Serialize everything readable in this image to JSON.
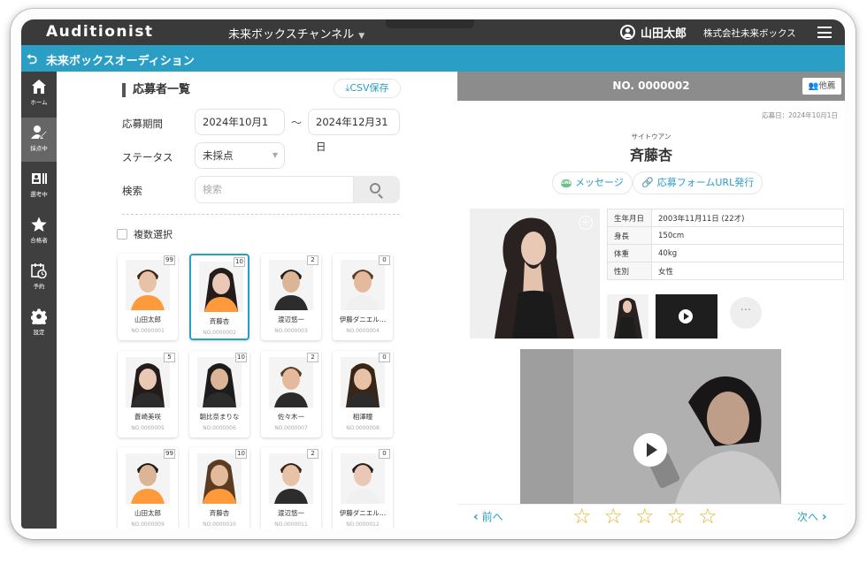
{
  "topbar": {
    "brand": "Auditionist",
    "channel": "未来ボックスチャンネル",
    "user_name": "山田太郎",
    "company": "株式会社未来ボックス"
  },
  "subbar": {
    "title": "未来ボックスオーディション"
  },
  "nav": [
    {
      "label": "ホーム",
      "icon": "home-icon"
    },
    {
      "label": "採点中",
      "icon": "scoring-icon",
      "active": true
    },
    {
      "label": "選考中",
      "icon": "selection-icon"
    },
    {
      "label": "合格者",
      "icon": "star-icon"
    },
    {
      "label": "予約",
      "icon": "calendar-icon"
    },
    {
      "label": "設定",
      "icon": "gear-icon"
    }
  ],
  "list": {
    "title": "応募者一覧",
    "csv_label": "CSV保存",
    "period_label": "応募期間",
    "date_from": "2024年10月1日",
    "date_sep": "〜",
    "date_to": "2024年12月31日",
    "status_label": "ステータス",
    "status_value": "未採点",
    "search_label": "検索",
    "search_placeholder": "検索",
    "multi_select": "複数選択",
    "applicants": [
      {
        "name": "山田太郎",
        "no": "NO.0000001",
        "count": "99"
      },
      {
        "name": "斉藤杏",
        "no": "NO.0000002",
        "count": "10"
      },
      {
        "name": "渡辺悠一",
        "no": "NO.0000003",
        "count": "2"
      },
      {
        "name": "伊藤ダニエル…",
        "no": "NO.0000004",
        "count": "0"
      },
      {
        "name": "蒼崎美咲",
        "no": "NO.0000005",
        "count": "5"
      },
      {
        "name": "朝比奈まりな",
        "no": "NO.0000006",
        "count": "10"
      },
      {
        "name": "佐々木一",
        "no": "NO.0000007",
        "count": "2"
      },
      {
        "name": "相澤瞳",
        "no": "NO.0000008",
        "count": "0"
      },
      {
        "name": "山田太郎",
        "no": "NO.0000009",
        "count": "99"
      },
      {
        "name": "斉藤杏",
        "no": "NO.0000010",
        "count": "10"
      },
      {
        "name": "渡辺悠一",
        "no": "NO.0000011",
        "count": "2"
      },
      {
        "name": "伊藤ダニエル…",
        "no": "NO.0000012",
        "count": "0"
      }
    ]
  },
  "detail": {
    "number": "NO. 0000002",
    "other_btn": "他薦",
    "apply_date": "応募日：2024年10月1日",
    "kana": "サイトウアン",
    "name": "斉藤杏",
    "message_btn": "メッセージ",
    "line_badge": "LINE",
    "url_btn": "応募フォームURL発行",
    "more": "···",
    "profile": [
      {
        "key": "生年月日",
        "value": "2003年11月11日 (22才)"
      },
      {
        "key": "身長",
        "value": "150cm"
      },
      {
        "key": "体重",
        "value": "40kg"
      },
      {
        "key": "性別",
        "value": "女性"
      }
    ],
    "prev": "前へ",
    "next": "次へ",
    "rating_stars": [
      "☆",
      "☆",
      "☆",
      "☆",
      "☆"
    ]
  },
  "colors": {
    "accent": "#2b9ec6",
    "topbar": "#3a3a3a",
    "star": "#e8b32d"
  }
}
